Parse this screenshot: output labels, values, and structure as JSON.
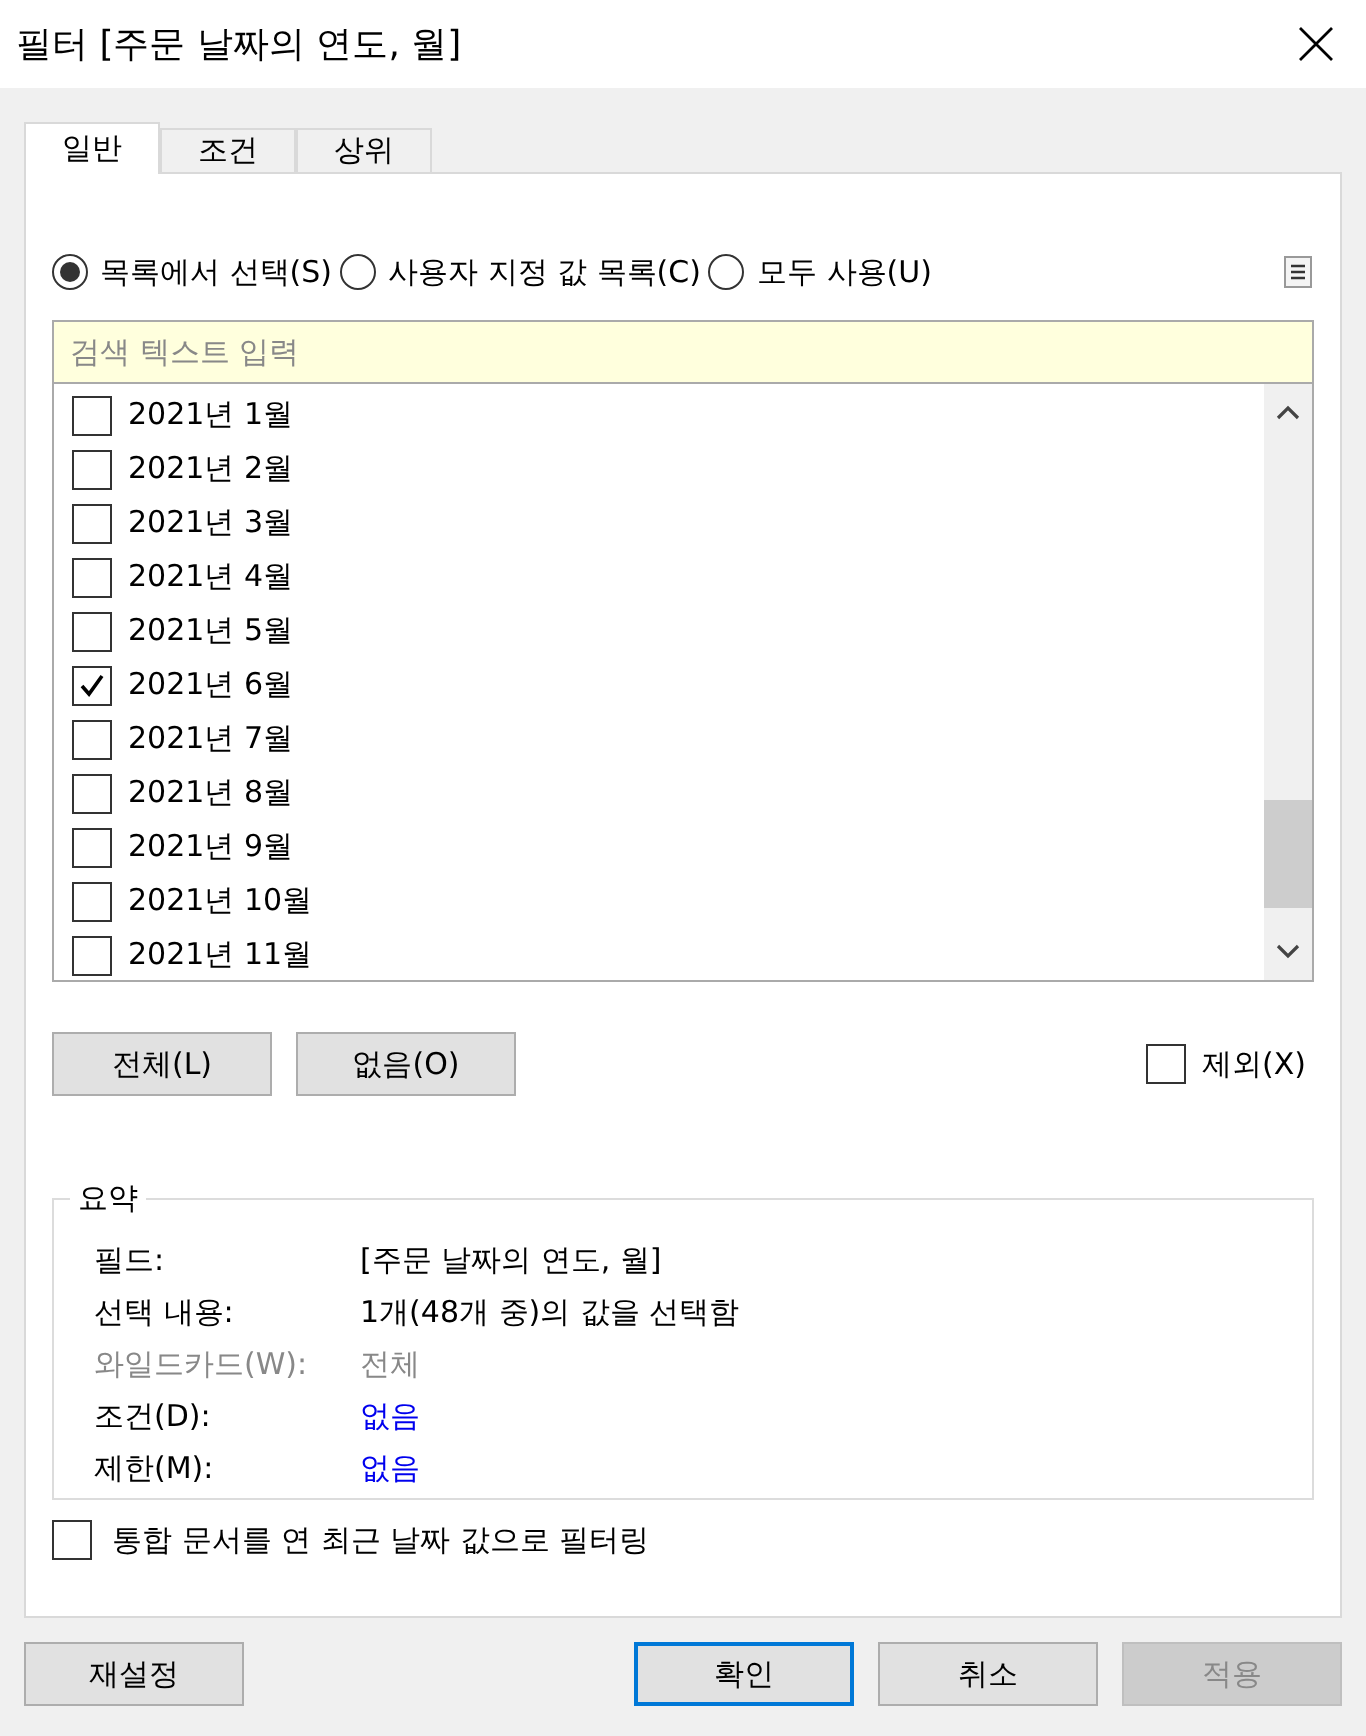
{
  "window": {
    "title": "필터 [주문 날짜의 연도, 월]"
  },
  "tabs": [
    {
      "label": "일반",
      "selected": true
    },
    {
      "label": "조건",
      "selected": false
    },
    {
      "label": "상위",
      "selected": false
    }
  ],
  "mode_options": [
    {
      "label": "목록에서 선택(S)",
      "selected": true
    },
    {
      "label": "사용자 지정 값 목록(C)",
      "selected": false
    },
    {
      "label": "모두 사용(U)",
      "selected": false
    }
  ],
  "search": {
    "placeholder": "검색 텍스트 입력"
  },
  "values": [
    {
      "label": "2021년 1월",
      "checked": false
    },
    {
      "label": "2021년 2월",
      "checked": false
    },
    {
      "label": "2021년 3월",
      "checked": false
    },
    {
      "label": "2021년 4월",
      "checked": false
    },
    {
      "label": "2021년 5월",
      "checked": false
    },
    {
      "label": "2021년 6월",
      "checked": true
    },
    {
      "label": "2021년 7월",
      "checked": false
    },
    {
      "label": "2021년 8월",
      "checked": false
    },
    {
      "label": "2021년 9월",
      "checked": false
    },
    {
      "label": "2021년 10월",
      "checked": false
    },
    {
      "label": "2021년 11월",
      "checked": false
    }
  ],
  "list_buttons": [
    "전체(L)",
    "없음(O)"
  ],
  "exclude": {
    "label": "제외(X)",
    "checked": false
  },
  "summary": {
    "title": "요약",
    "rows": [
      {
        "label": "필드:",
        "value": "[주문 날짜의 연도, 월]",
        "kind": "text",
        "disabled": false
      },
      {
        "label": "선택 내용:",
        "value": "1개(48개 중)의 값을 선택함",
        "kind": "text",
        "disabled": false
      },
      {
        "label": "와일드카드(W):",
        "value": "전체",
        "kind": "text",
        "disabled": true
      },
      {
        "label": "조건(D):",
        "value": "없음",
        "kind": "link",
        "disabled": false
      },
      {
        "label": "제한(M):",
        "value": "없음",
        "kind": "link",
        "disabled": false
      }
    ]
  },
  "latest_date": {
    "label": "통합 문서를 연 최근 날짜 값으로 필터링",
    "checked": false
  },
  "buttons": [
    {
      "label": "재설정",
      "kind": "reset",
      "disabled": false
    },
    {
      "label": "확인",
      "kind": "default",
      "disabled": false
    },
    {
      "label": "취소",
      "kind": "normal",
      "disabled": false
    },
    {
      "label": "적용",
      "kind": "normal",
      "disabled": true
    }
  ]
}
